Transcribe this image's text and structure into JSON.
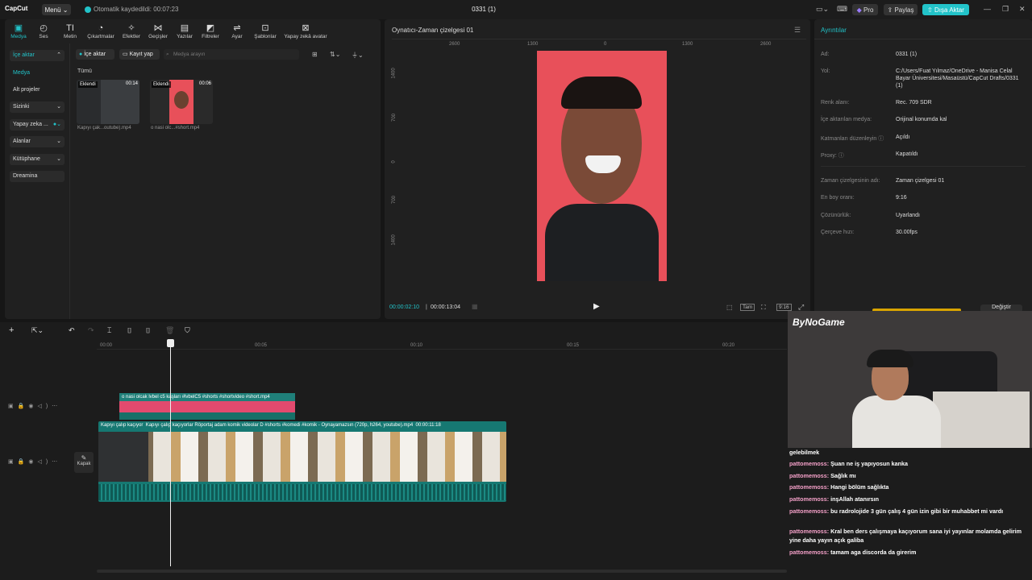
{
  "titlebar": {
    "logo": "CapCut",
    "menu": "Menü",
    "autosave": "Otomatik kaydedildi: 00:07:23",
    "title": "0331 (1)",
    "pro": "Pro",
    "share": "Paylaş",
    "export": "Dışa Aktar"
  },
  "toolbar": [
    {
      "label": "Medya",
      "icon": "media-icon"
    },
    {
      "label": "Ses",
      "icon": "audio-icon"
    },
    {
      "label": "Metin",
      "icon": "text-icon"
    },
    {
      "label": "Çıkartmalar",
      "icon": "sticker-icon"
    },
    {
      "label": "Efektler",
      "icon": "effects-icon"
    },
    {
      "label": "Geçişler",
      "icon": "transitions-icon"
    },
    {
      "label": "Yazılar",
      "icon": "captions-icon"
    },
    {
      "label": "Filtreler",
      "icon": "filters-icon"
    },
    {
      "label": "Ayar",
      "icon": "adjust-icon"
    },
    {
      "label": "Şablonlar",
      "icon": "templates-icon"
    },
    {
      "label": "Yapay zekâ avatar",
      "icon": "avatar-icon"
    }
  ],
  "sidebar": {
    "items": [
      "İçe aktar",
      "Medya",
      "Alt projeler",
      "Sizinki",
      "Yapay zeka ...",
      "Alanlar",
      "Kütüphane",
      "Dreamina"
    ]
  },
  "media": {
    "import": "İçe aktar",
    "record": "Kayıt yap",
    "search_placeholder": "Medya arayın",
    "all": "Tümü",
    "items": [
      {
        "tag": "Eklendi",
        "duration": "00:14",
        "name": "Kapıyı çak...outube).mp4"
      },
      {
        "tag": "Eklendi",
        "duration": "00:06",
        "name": "o nasi olc...#short.mp4"
      }
    ]
  },
  "player": {
    "title": "Oynatıcı-Zaman çizelgesi 01",
    "ruler": [
      "2600",
      "1300",
      "0",
      "1300",
      "2600"
    ],
    "vruler": [
      "1400",
      "700",
      "0",
      "700",
      "1400"
    ],
    "current": "00:00:02:10",
    "total": "00:00:13:04",
    "controls": [
      "Tam",
      "9:16"
    ]
  },
  "details": {
    "title": "Ayrıntılar",
    "rows": [
      {
        "k": "Ad:",
        "v": "0331 (1)"
      },
      {
        "k": "Yol:",
        "v": "C:/Users/Fuat Yılmaz/OneDrive - Manisa Celal Bayar Üniversitesi/Masaüstü/CapCut Drafts/0331 (1)"
      },
      {
        "k": "Renk alanı:",
        "v": "Rec. 709 SDR"
      },
      {
        "k": "İçe aktarılan medya:",
        "v": "Orijinal konumda kal"
      },
      {
        "k": "Katmanları düzenleyin",
        "v": "Açıldı"
      },
      {
        "k": "Proxy:",
        "v": "Kapatıldı"
      },
      {
        "k": "Zaman çizelgesinin adı:",
        "v": "Zaman çizelgesi 01"
      },
      {
        "k": "En boy oranı:",
        "v": "9:16"
      },
      {
        "k": "Çözünürlük:",
        "v": "Uyarlandı"
      },
      {
        "k": "Çerçeve hızı:",
        "v": "30.00fps"
      }
    ],
    "change": "Değiştir"
  },
  "timeline": {
    "ticks": [
      "00:00",
      "00:05",
      "00:10",
      "00:15",
      "00:20"
    ],
    "clip1": "o nasi olcak  lvbel c5 kaşları #lvbelC5 #shorts #shortvideo #short.mp4",
    "clip2_head": "Kapıyı çalıp kaçıyor",
    "clip2": "Kapıyı çalıp kaçıyorlar Röportaj adam komik videolar D #shorts #komedi #komik - Oynayamazsın (720p, h264, youtube).mp4",
    "clip2_dur": "00:00:11:18",
    "cover": "Kapak"
  },
  "overlay": {
    "brand": "ByNoGame",
    "chat": [
      {
        "user": "",
        "msg": "gelebilmek"
      },
      {
        "user": "pattomemoss:",
        "msg": "Şuan ne iş yapıyosun kanka"
      },
      {
        "user": "pattomemoss:",
        "msg": "Sağlık mı"
      },
      {
        "user": "pattomemoss:",
        "msg": "Hangi bölüm sağlıkta"
      },
      {
        "user": "pattomemoss:",
        "msg": "inşAllah atanırsın"
      },
      {
        "user": "pattomemoss:",
        "msg": "bu radrolojide 3 gün çalış 4 gün izin gibi bir muhabbet mi vardı"
      },
      {
        "user": "pattomemoss:",
        "msg": "Kral ben ders çalışmaya kaçıyorum sana iyi yayınlar molamda gelirim yine daha yayın açık galiba"
      },
      {
        "user": "pattomemoss:",
        "msg": "tamam aga discorda da girerim"
      }
    ]
  },
  "colors": {
    "accent": "#22c3c9",
    "bg": "#161616",
    "panel": "#202020"
  }
}
